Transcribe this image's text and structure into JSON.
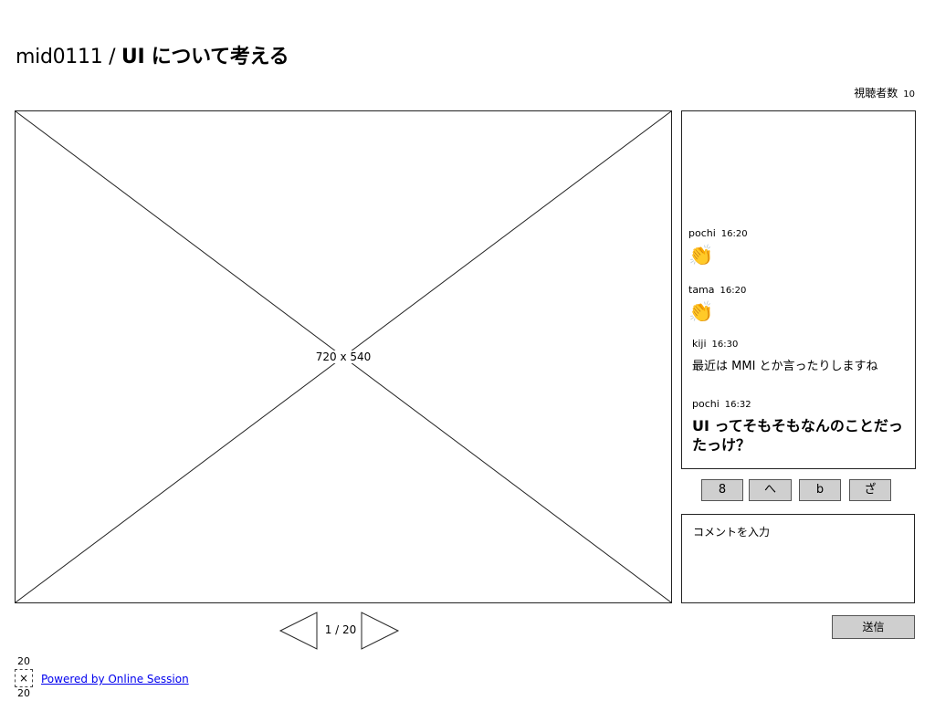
{
  "header": {
    "session_id": "mid0111",
    "separator": " / ",
    "title": "UI について考える"
  },
  "viewers": {
    "label": "視聴者数",
    "count": "10"
  },
  "slide": {
    "placeholder_label": "720 x 540",
    "page_indicator": "1 / 20"
  },
  "chat": {
    "messages": [
      {
        "user": "pochi",
        "time": "16:20",
        "content": "👏",
        "type": "emoji"
      },
      {
        "user": "tama",
        "time": "16:20",
        "content": "👏",
        "type": "emoji"
      },
      {
        "user": "kiji",
        "time": "16:30",
        "content": "最近は MMI とか言ったりしますね",
        "type": "text"
      },
      {
        "user": "pochi",
        "time": "16:32",
        "content": "UI ってそもそもなんのことだったっけ？",
        "type": "large_text"
      }
    ]
  },
  "reactions": [
    "8",
    "へ",
    "b",
    "ざ"
  ],
  "comment": {
    "placeholder": "コメントを入力"
  },
  "send_button": {
    "label": "送信"
  },
  "footer": {
    "icon_width_label": "20",
    "icon_glyph": "×",
    "icon_height_label": "20",
    "powered_by": "Powered by Online Session"
  }
}
